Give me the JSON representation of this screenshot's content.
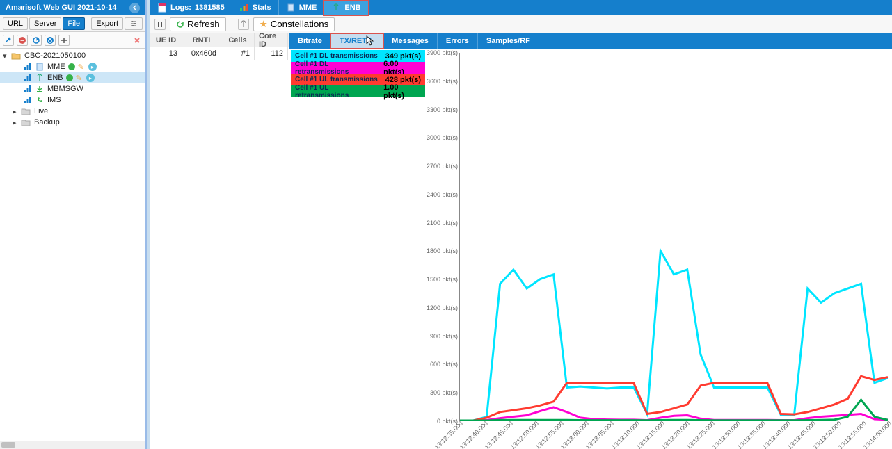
{
  "app": {
    "title": "Amarisoft Web GUI 2021-10-14"
  },
  "left_toolbar": {
    "url": "URL",
    "server": "Server",
    "file": "File",
    "export": "Export"
  },
  "tree": {
    "root": "CBC-2021050100",
    "items": [
      {
        "label": "MME",
        "status": "ok",
        "selected": false
      },
      {
        "label": "ENB",
        "status": "ok",
        "selected": true
      },
      {
        "label": "MBMSGW",
        "status": "down",
        "selected": false
      },
      {
        "label": "IMS",
        "status": "phone",
        "selected": false
      }
    ],
    "live": "Live",
    "backup": "Backup"
  },
  "top_tabs": {
    "logs": {
      "label": "Logs:",
      "value": "1381585"
    },
    "stats": "Stats",
    "mme": "MME",
    "enb": "ENB"
  },
  "action_bar": {
    "refresh": "Refresh",
    "constellations": "Constellations"
  },
  "ue_table": {
    "headers": {
      "ueid": "UE ID",
      "rnti": "RNTI",
      "cells": "Cells",
      "core": "Core ID"
    },
    "rows": [
      {
        "ueid": "13",
        "rnti": "0x460d",
        "cells": "#1",
        "core": "112"
      }
    ]
  },
  "subtabs": {
    "bitrate": "Bitrate",
    "txretx": "TX/RETX",
    "messages": "Messages",
    "errors": "Errors",
    "samples": "Samples/RF"
  },
  "legend": [
    {
      "label": "Cell #1 DL transmissions",
      "value": "349 pkt(s)",
      "cls": "lg-cyan"
    },
    {
      "label": "Cell #1 DL retransmissions",
      "value": "6.00 pkt(s)",
      "cls": "lg-magenta"
    },
    {
      "label": "Cell #1 UL transmissions",
      "value": "428 pkt(s)",
      "cls": "lg-red"
    },
    {
      "label": "Cell #1 UL retransmissions",
      "value": "1.00 pkt(s)",
      "cls": "lg-green"
    }
  ],
  "chart_data": {
    "type": "line",
    "xlabel": "",
    "ylabel": "",
    "ylim": [
      0,
      3900
    ],
    "y_ticks": [
      0,
      300,
      600,
      900,
      1200,
      1500,
      1800,
      2100,
      2400,
      2700,
      3000,
      3300,
      3600,
      3900
    ],
    "y_tick_label": "pkt(s)",
    "x_ticks": [
      "13:12:35.000",
      "13:12:40.000",
      "13:12:45.000",
      "13:12:50.000",
      "13:12:55.000",
      "13:13:00.000",
      "13:13:05.000",
      "13:13:10.000",
      "13:13:15.000",
      "13:13:20.000",
      "13:13:25.000",
      "13:13:30.000",
      "13:13:35.000",
      "13:13:40.000",
      "13:13:45.000",
      "13:13:50.000",
      "13:13:55.000",
      "13:14:00.000"
    ],
    "series": [
      {
        "name": "Cell #1 DL transmissions",
        "color": "#00e5ff",
        "values": [
          0,
          0,
          40,
          1450,
          1600,
          1400,
          1500,
          1550,
          350,
          360,
          350,
          340,
          350,
          350,
          70,
          1800,
          1550,
          1600,
          700,
          350,
          350,
          350,
          350,
          350,
          60,
          60,
          1400,
          1250,
          1350,
          1400,
          1450,
          400,
          450
        ]
      },
      {
        "name": "Cell #1 DL retransmissions",
        "color": "#ff00d4",
        "values": [
          0,
          0,
          5,
          25,
          40,
          55,
          100,
          140,
          90,
          30,
          15,
          10,
          8,
          8,
          4,
          30,
          50,
          55,
          20,
          6,
          6,
          6,
          6,
          6,
          4,
          4,
          25,
          40,
          50,
          60,
          70,
          15,
          8
        ]
      },
      {
        "name": "Cell #1 UL transmissions",
        "color": "#ff3b30",
        "values": [
          0,
          0,
          30,
          90,
          110,
          130,
          160,
          200,
          400,
          400,
          395,
          395,
          395,
          395,
          70,
          90,
          130,
          170,
          370,
          400,
          395,
          395,
          395,
          395,
          70,
          65,
          90,
          130,
          170,
          230,
          470,
          430,
          460
        ]
      },
      {
        "name": "Cell #1 UL retransmissions",
        "color": "#00a651",
        "values": [
          0,
          0,
          0,
          5,
          6,
          6,
          6,
          6,
          5,
          4,
          3,
          3,
          3,
          3,
          2,
          5,
          6,
          6,
          4,
          2,
          2,
          2,
          2,
          2,
          2,
          2,
          4,
          6,
          8,
          40,
          220,
          40,
          6
        ]
      }
    ]
  }
}
